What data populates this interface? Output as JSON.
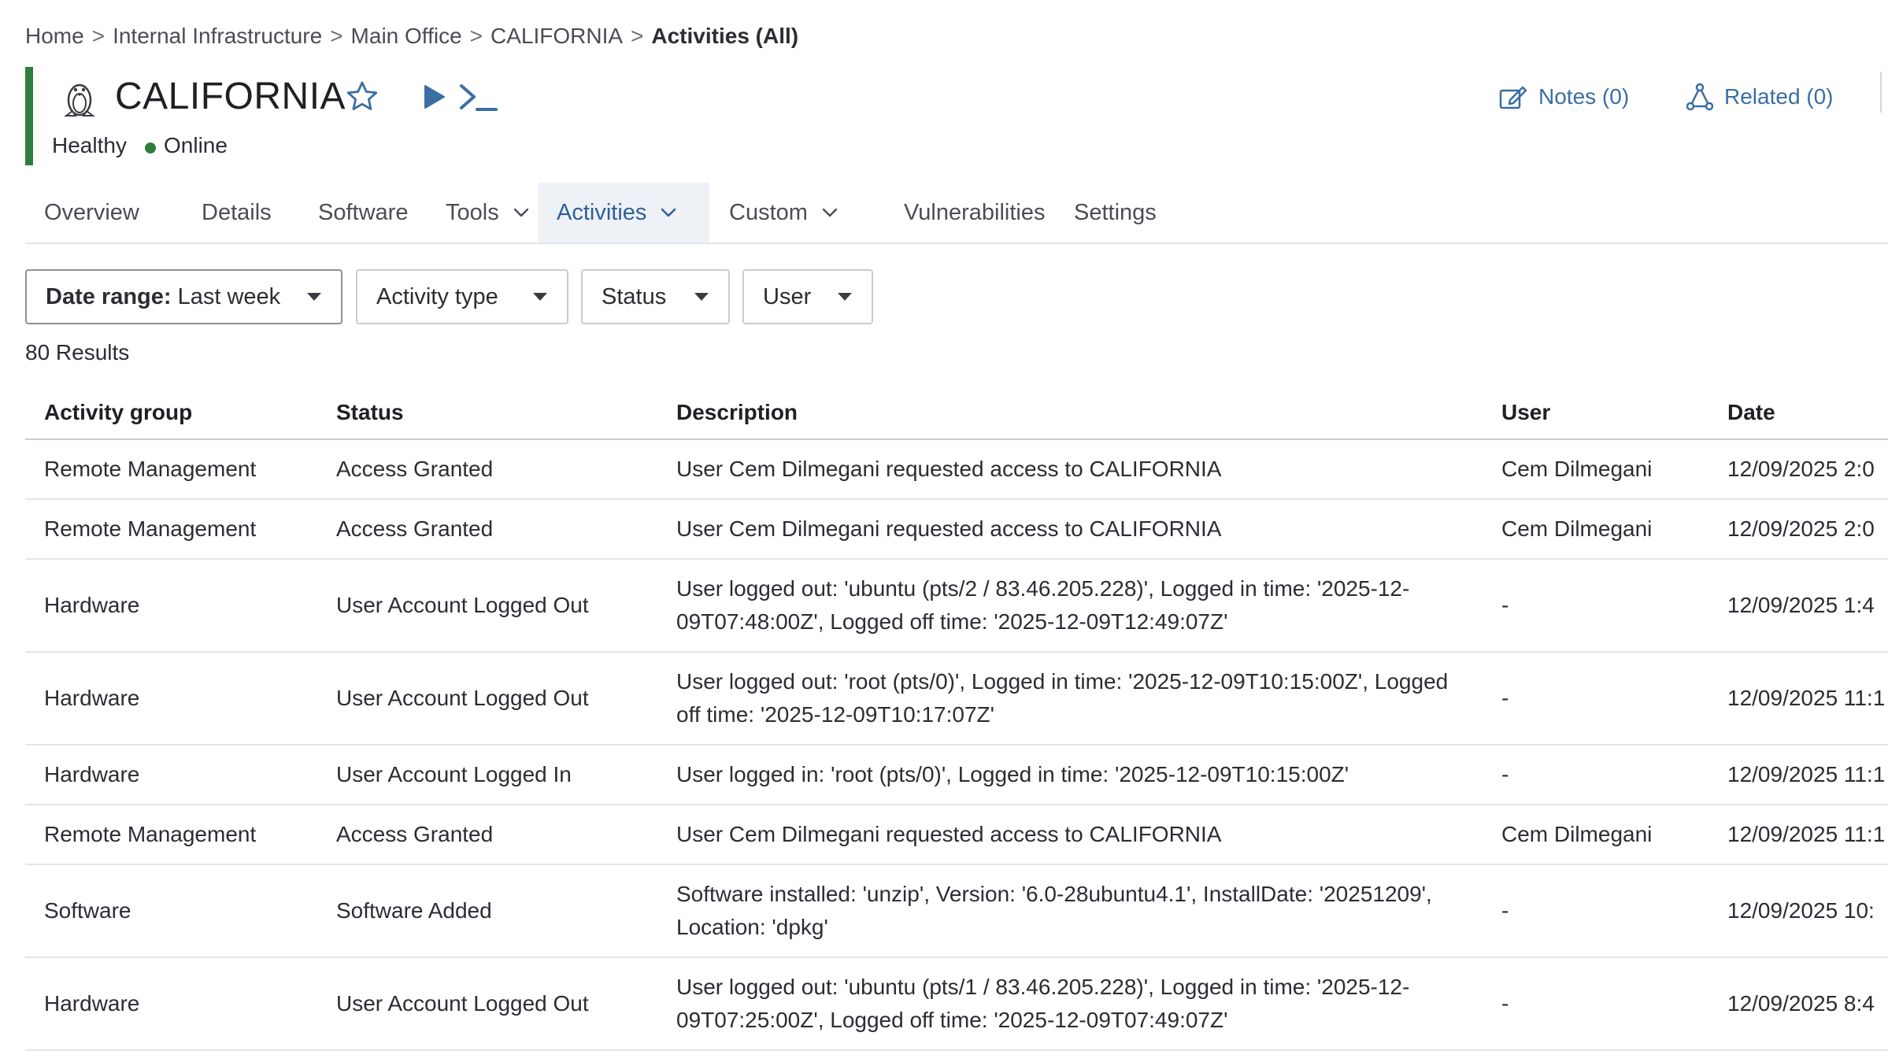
{
  "breadcrumb": [
    {
      "label": "Home"
    },
    {
      "label": "Internal Infrastructure"
    },
    {
      "label": "Main Office"
    },
    {
      "label": "CALIFORNIA"
    },
    {
      "label": "Activities (All)"
    }
  ],
  "device": {
    "name": "CALIFORNIA",
    "health": "Healthy",
    "status": "Online",
    "os_icon": "linux-penguin-icon",
    "status_color": "#2f7d3d"
  },
  "header_actions": {
    "notes_label": "Notes (0)",
    "related_label": "Related (0)"
  },
  "tabs": [
    {
      "label": "Overview"
    },
    {
      "label": "Details"
    },
    {
      "label": "Software"
    },
    {
      "label": "Tools"
    },
    {
      "label": "Activities"
    },
    {
      "label": "Custom"
    },
    {
      "label": "Vulnerabilities"
    },
    {
      "label": "Settings"
    }
  ],
  "filters": {
    "date_range_label": "Date range:",
    "date_range_value": "Last week",
    "activity_type": "Activity type",
    "status": "Status",
    "user": "User"
  },
  "results_text": "80 Results",
  "table": {
    "columns": [
      "Activity group",
      "Status",
      "Description",
      "User",
      "Date"
    ],
    "rows": [
      {
        "group": "Remote Management",
        "status": "Access Granted",
        "description": "User Cem Dilmegani requested access to CALIFORNIA",
        "user": "Cem Dilmegani",
        "date": "12/09/2025 2:0"
      },
      {
        "group": "Remote Management",
        "status": "Access Granted",
        "description": "User Cem Dilmegani requested access to CALIFORNIA",
        "user": "Cem Dilmegani",
        "date": "12/09/2025 2:0"
      },
      {
        "group": "Hardware",
        "status": "User Account Logged Out",
        "description": "User logged out: 'ubuntu (pts/2 / 83.46.205.228)', Logged in time: '2025-12-09T07:48:00Z', Logged off time: '2025-12-09T12:49:07Z'",
        "user": "-",
        "date": "12/09/2025 1:4"
      },
      {
        "group": "Hardware",
        "status": "User Account Logged Out",
        "description": "User logged out: 'root (pts/0)', Logged in time: '2025-12-09T10:15:00Z', Logged off time: '2025-12-09T10:17:07Z'",
        "user": "-",
        "date": "12/09/2025 11:1"
      },
      {
        "group": "Hardware",
        "status": "User Account Logged In",
        "description": "User logged in: 'root (pts/0)', Logged in time: '2025-12-09T10:15:00Z'",
        "user": "-",
        "date": "12/09/2025 11:1"
      },
      {
        "group": "Remote Management",
        "status": "Access Granted",
        "description": "User Cem Dilmegani requested access to CALIFORNIA",
        "user": "Cem Dilmegani",
        "date": "12/09/2025 11:1"
      },
      {
        "group": "Software",
        "status": "Software Added",
        "description": "Software installed: 'unzip', Version: '6.0-28ubuntu4.1', InstallDate: '20251209', Location: 'dpkg'",
        "user": "-",
        "date": "12/09/2025 10:"
      },
      {
        "group": "Hardware",
        "status": "User Account Logged Out",
        "description": "User logged out: 'ubuntu (pts/1 / 83.46.205.228)', Logged in time: '2025-12-09T07:25:00Z', Logged off time: '2025-12-09T07:49:07Z'",
        "user": "-",
        "date": "12/09/2025 8:4"
      }
    ]
  },
  "colors": {
    "accent": "#3a6ea5",
    "active_tab_text": "#2f5f99",
    "health_bar": "#2f7d3d"
  }
}
